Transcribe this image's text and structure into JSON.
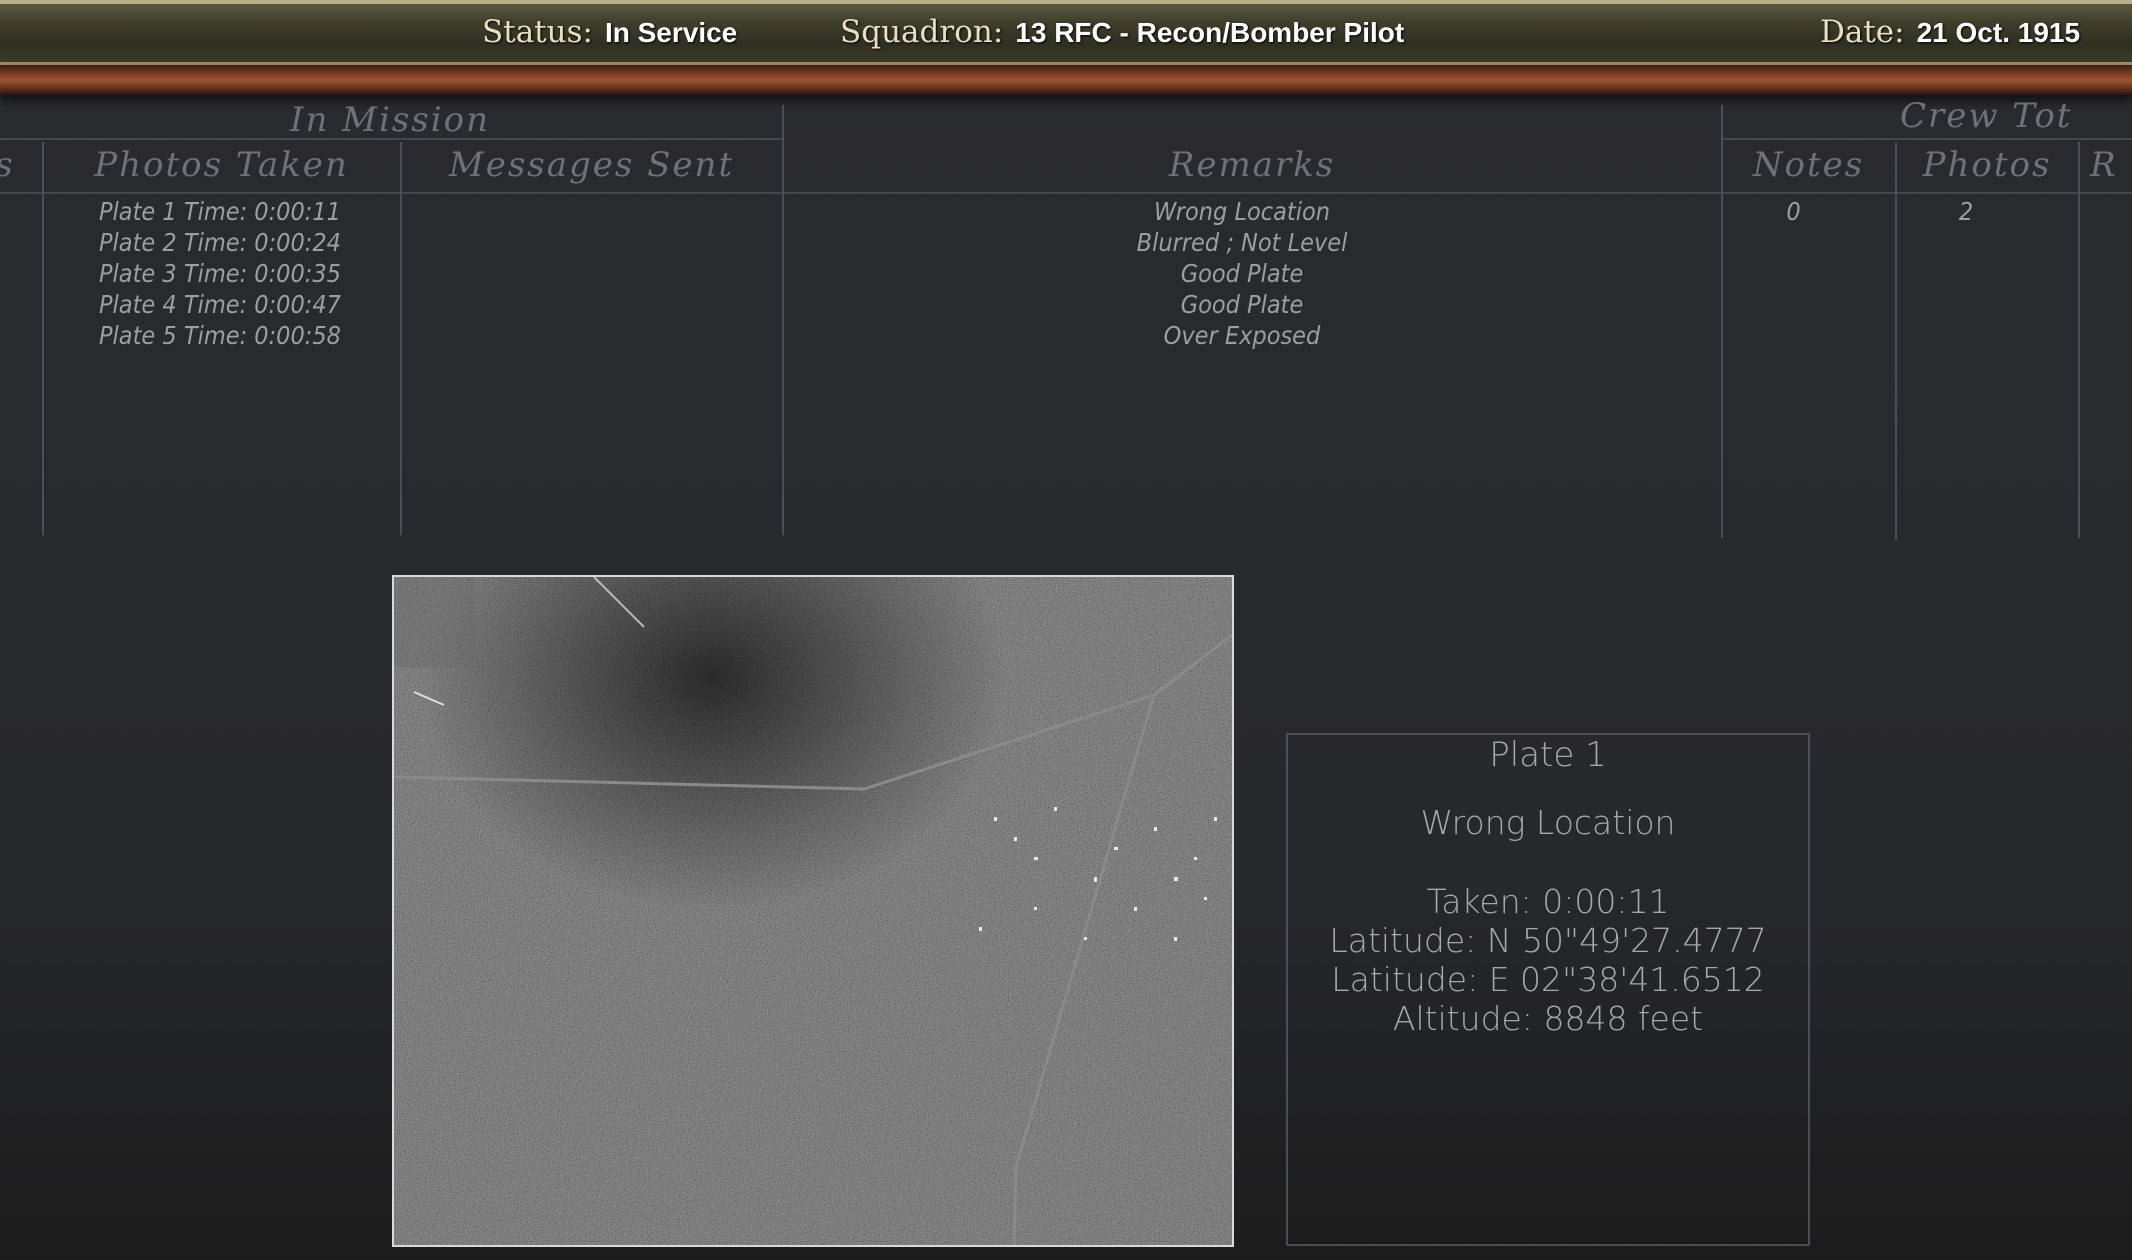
{
  "topbar": {
    "status_label": "Status:",
    "status_value": "In Service",
    "squadron_label": "Squadron:",
    "squadron_value": "13 RFC - Recon/Bomber Pilot",
    "date_label": "Date:",
    "date_value": "21 Oct. 1915"
  },
  "table": {
    "group_in_mission": "In Mission",
    "group_crew_totals": "Crew Tot",
    "col_partial_left": "s",
    "col_photos_taken": "Photos Taken",
    "col_messages_sent": "Messages Sent",
    "col_remarks": "Remarks",
    "col_notes": "Notes",
    "col_photos": "Photos",
    "col_partial_right": "R",
    "photos_taken": [
      "Plate 1 Time: 0:00:11",
      "Plate 2 Time: 0:00:24",
      "Plate 3 Time: 0:00:35",
      "Plate 4 Time: 0:00:47",
      "Plate 5 Time: 0:00:58"
    ],
    "remarks": [
      "Wrong Location",
      "Blurred ; Not Level",
      "Good Plate",
      "Good Plate",
      "Over Exposed"
    ],
    "notes_total": "0",
    "photos_total": "2"
  },
  "plate_info": {
    "title": "Plate 1",
    "remark": "Wrong Location",
    "taken": "Taken: 0:00:11",
    "latitude_n": "Latitude: N 50\"49'27.4777",
    "latitude_e": "Latitude: E 02\"38'41.6512",
    "altitude": "Altitude: 8848 feet"
  },
  "colors": {
    "background": "#28292b",
    "topbar": "#3f3f2c",
    "wood_frame": "#7a3e22",
    "script_text": "#6f7174",
    "cell_text": "#9c9ea0"
  }
}
